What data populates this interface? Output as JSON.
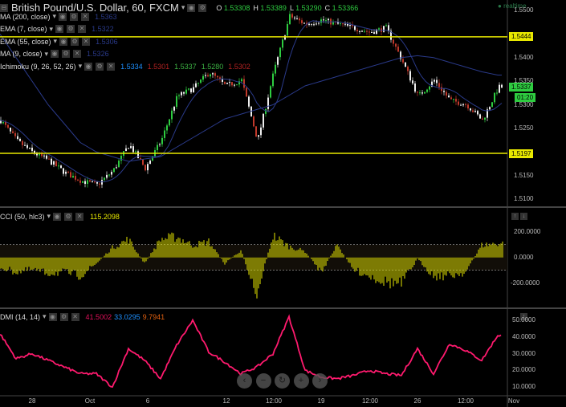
{
  "header": {
    "title": "British Pound/U.S. Dollar, 60, FXCM",
    "ohlc": [
      {
        "k": "O",
        "v": "1.53308"
      },
      {
        "k": "H",
        "v": "1.53389"
      },
      {
        "k": "L",
        "v": "1.53290"
      },
      {
        "k": "C",
        "v": "1.53366"
      }
    ],
    "status": "realtime"
  },
  "indicators": [
    {
      "label": "MA (200, close)",
      "values": [
        {
          "v": "1.5363",
          "c": "#2a3a8a"
        }
      ]
    },
    {
      "label": "EMA (7, close)",
      "values": [
        {
          "v": "1.5322",
          "c": "#2a3a8a"
        }
      ]
    },
    {
      "label": "EMA (55, close)",
      "values": [
        {
          "v": "1.5306",
          "c": "#2a3a8a"
        }
      ]
    },
    {
      "label": "MA (9, close)",
      "values": [
        {
          "v": "1.5326",
          "c": "#2a3a8a"
        }
      ]
    },
    {
      "label": "Ichimoku (9, 26, 52, 26)",
      "values": [
        {
          "v": "1.5334",
          "c": "#1e90ff"
        },
        {
          "v": "1.5301",
          "c": "#b22222"
        },
        {
          "v": "1.5337",
          "c": "#3cb043"
        },
        {
          "v": "1.5280",
          "c": "#3cb043"
        },
        {
          "v": "1.5302",
          "c": "#b22222"
        }
      ]
    }
  ],
  "price_axis": [
    "1.5500",
    "1.5400",
    "1.5350",
    "1.5300",
    "1.5250",
    "1.5150",
    "1.5100"
  ],
  "price_tags": {
    "upper_line": "1.5444",
    "lower_line": "1.5197",
    "last": "1.5337",
    "countdown": "01:20"
  },
  "cci": {
    "label": "CCI (50, hlc3)",
    "value": "115.2098",
    "axis": [
      "200.0000",
      "0.0000",
      "-200.0000"
    ]
  },
  "dmi": {
    "label": "DMI (14, 14)",
    "values": [
      {
        "v": "41.5002",
        "c": "#e0105a"
      },
      {
        "v": "33.0295",
        "c": "#1e90ff"
      },
      {
        "v": "9.7941",
        "c": "#e06010"
      }
    ],
    "axis": [
      "50.0000",
      "40.0000",
      "30.0000",
      "20.0000",
      "10.0000"
    ]
  },
  "time_axis": [
    "28",
    "Oct",
    "6",
    "12",
    "12:00",
    "19",
    "12:00",
    "26",
    "12:00",
    "Nov"
  ],
  "nav": [
    {
      "name": "scroll-left",
      "glyph": "‹"
    },
    {
      "name": "zoom-out",
      "glyph": "−"
    },
    {
      "name": "reset",
      "glyph": "↻"
    },
    {
      "name": "zoom-in",
      "glyph": "+"
    },
    {
      "name": "scroll-right",
      "glyph": "›"
    }
  ],
  "chart_data": [
    {
      "type": "candlestick",
      "series": [
        {
          "name": "close",
          "values": [
            1.5267,
            1.5224,
            1.5199,
            1.5182,
            1.5156,
            1.5139,
            1.513,
            1.516,
            1.5216,
            1.5165,
            1.5224,
            1.5318,
            1.5335,
            1.5369,
            1.534,
            1.5352,
            1.5224,
            1.5369,
            1.5488,
            1.5471,
            1.548,
            1.5471,
            1.5463,
            1.5454,
            1.5463,
            1.5394,
            1.5318,
            1.5352,
            1.5309,
            1.5301,
            1.5267,
            1.5337
          ]
        },
        {
          "name": "MA (200, close)",
          "values": [
            1.545,
            1.54,
            1.535,
            1.53,
            1.526,
            1.522,
            1.52,
            1.519,
            1.518,
            1.5185,
            1.519,
            1.521,
            1.523,
            1.525,
            1.527,
            1.528,
            1.529,
            1.53,
            1.532,
            1.534,
            1.535,
            1.536,
            1.537,
            1.538,
            1.539,
            1.54,
            1.5404,
            1.54,
            1.539,
            1.538,
            1.537,
            1.5363
          ]
        }
      ],
      "horizontal_lines": [
        1.5444,
        1.5197
      ],
      "ylim": [
        1.5085,
        1.551
      ]
    },
    {
      "type": "bar",
      "title": "CCI (50, hlc3)",
      "values": [
        -80,
        -120,
        -100,
        -130,
        -120,
        -150,
        -50,
        80,
        150,
        -50,
        150,
        170,
        100,
        130,
        -50,
        60,
        -300,
        180,
        90,
        50,
        -120,
        100,
        -100,
        -150,
        -200,
        -220,
        -10,
        -150,
        -150,
        -120,
        100,
        115
      ],
      "bands": [
        -100,
        100
      ],
      "ylim": [
        -350,
        330
      ]
    },
    {
      "type": "line",
      "title": "DMI (14, 14)",
      "values": [
        42,
        27,
        30,
        26,
        22,
        18,
        18,
        10,
        33,
        26,
        15,
        35,
        50,
        31,
        25,
        18,
        22,
        30,
        52,
        20,
        16,
        15,
        17,
        20,
        18,
        17,
        33,
        18,
        36,
        32,
        26,
        41
      ],
      "ylim": [
        5,
        55
      ]
    }
  ]
}
